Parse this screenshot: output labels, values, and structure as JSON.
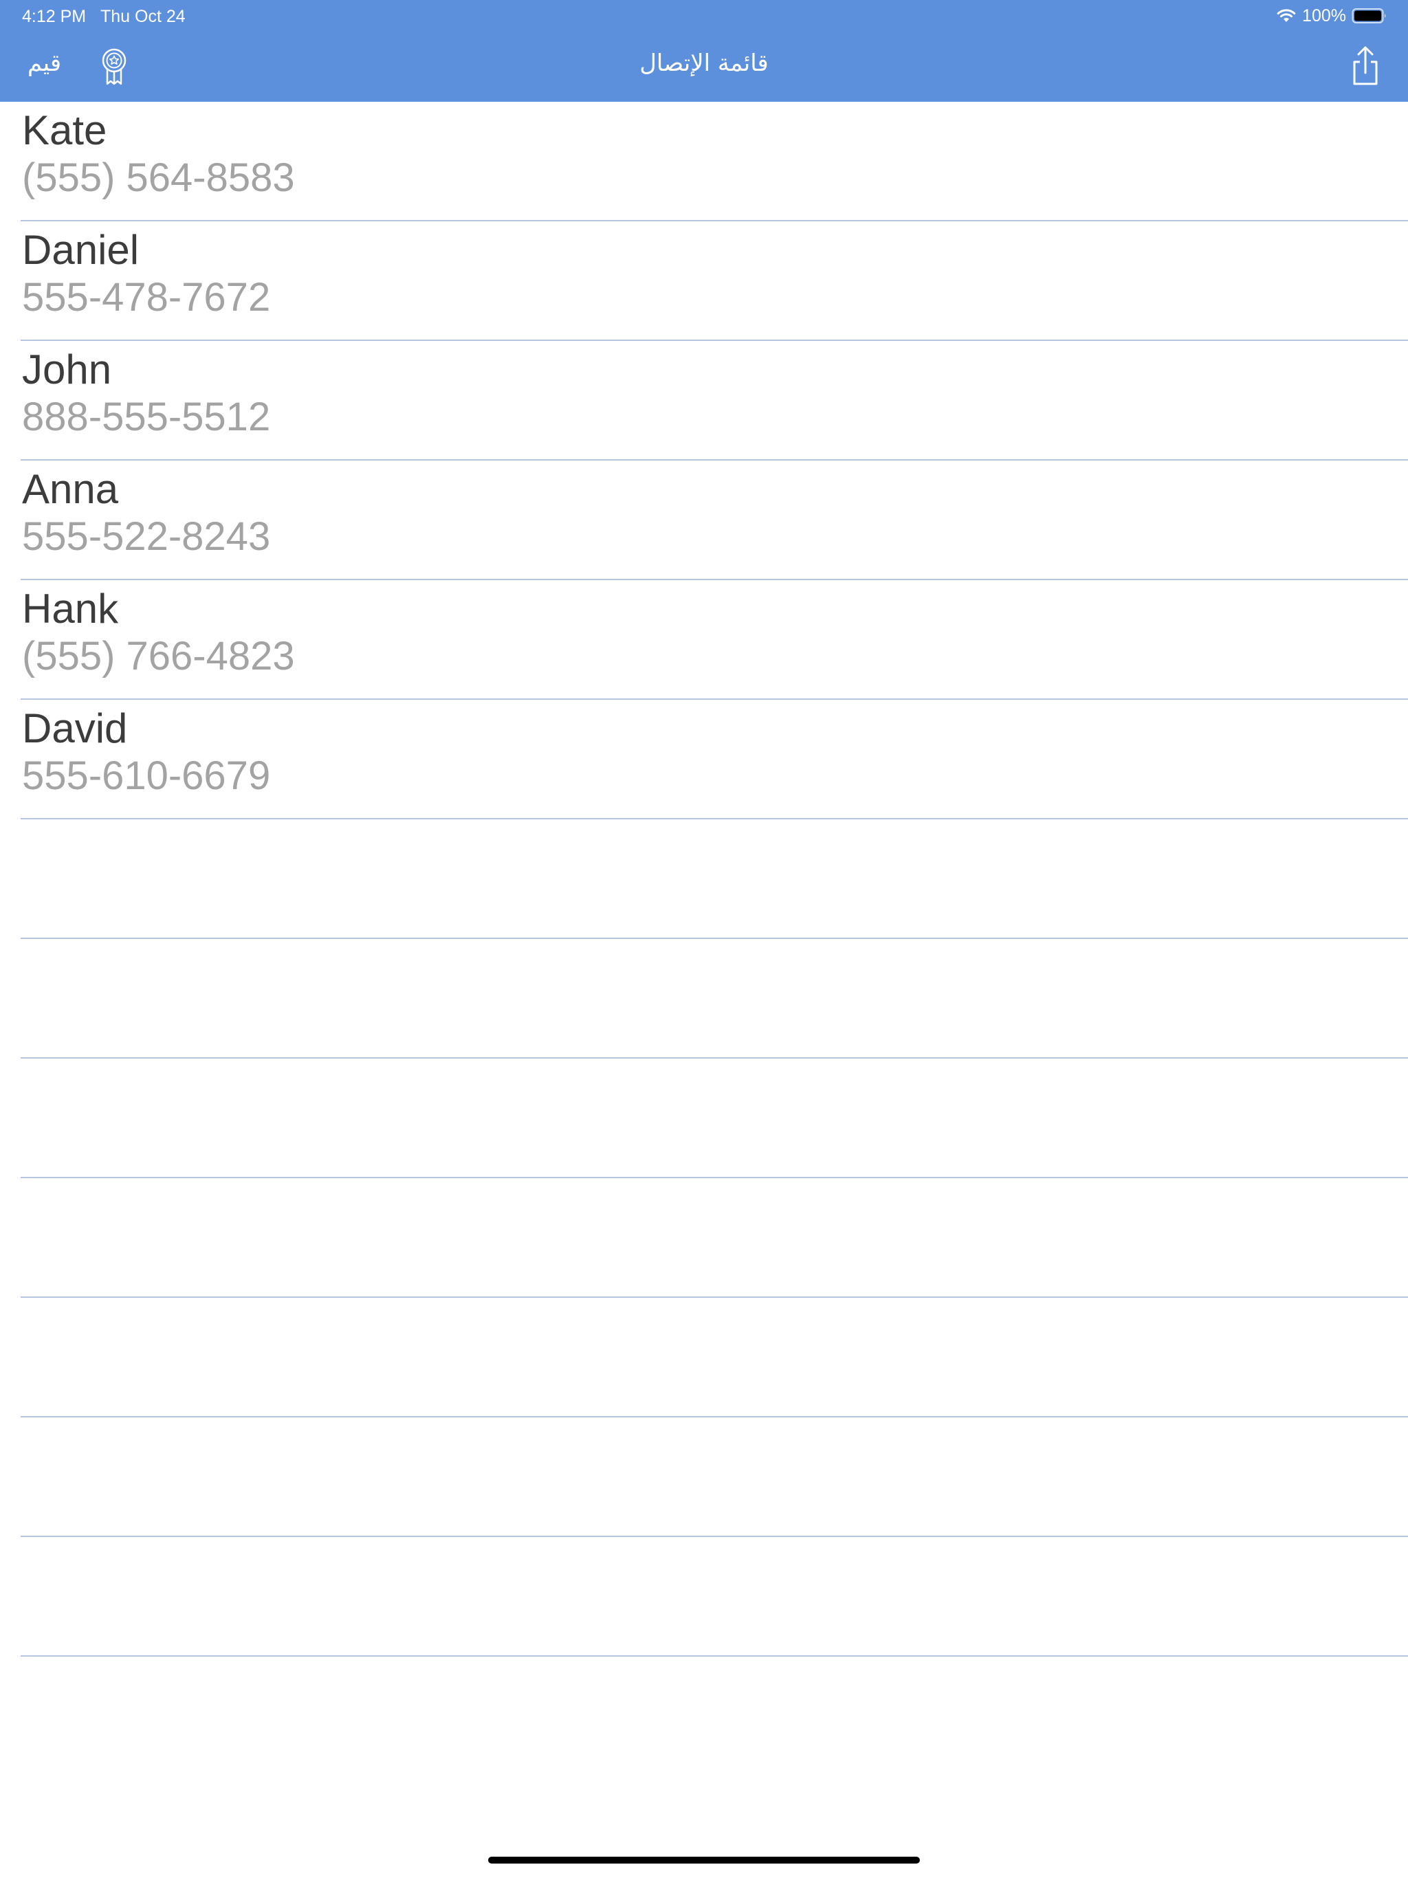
{
  "status_bar": {
    "time": "4:12 PM",
    "date": "Thu Oct 24",
    "battery_percent": "100%",
    "wifi_icon": "wifi-icon",
    "battery_icon": "battery-icon"
  },
  "nav_bar": {
    "title": "قائمة الإتصال",
    "rate_label": "قيم",
    "award_icon": "award-ribbon-icon",
    "share_icon": "share-icon"
  },
  "contacts": [
    {
      "name": "Kate",
      "phone": "(555) 564-8583"
    },
    {
      "name": "Daniel",
      "phone": "555-478-7672"
    },
    {
      "name": "John",
      "phone": "888-555-5512"
    },
    {
      "name": "Anna",
      "phone": "555-522-8243"
    },
    {
      "name": "Hank",
      "phone": "(555) 766-4823"
    },
    {
      "name": "David",
      "phone": "555-610-6679"
    }
  ],
  "colors": {
    "nav_background": "#5d90dc",
    "separator": "#b5c6de",
    "name_text": "#3c3c3c",
    "phone_text": "#a3a3a3"
  }
}
